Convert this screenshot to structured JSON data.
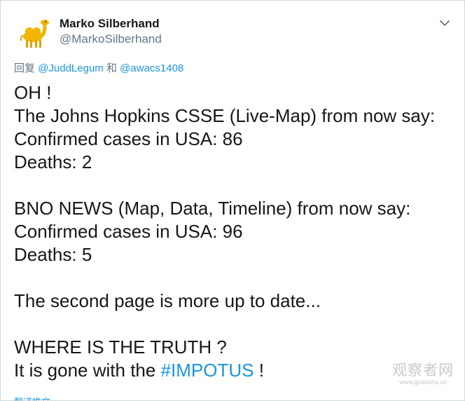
{
  "author": {
    "display_name": "Marko Silberhand",
    "handle": "@MarkoSilberhand",
    "avatar": "camel-avatar-icon"
  },
  "menu": {
    "icon": "chevron-down-icon"
  },
  "reply_to": {
    "prefix": "回复 ",
    "mention1": "@JuddLegum",
    "conjunction": " 和 ",
    "mention2": "@awacs1408"
  },
  "body": {
    "line1": "OH !",
    "line2": "The Johns Hopkins CSSE (Live-Map) from now say:",
    "line3": "Confirmed cases in USA: 86",
    "line4": "Deaths: 2",
    "line5": "BNO NEWS (Map, Data, Timeline) from now say:",
    "line6": "Confirmed cases in USA: 96",
    "line7": "Deaths: 5",
    "line8": "The second page is more up to date...",
    "line9": "WHERE IS THE TRUTH ?",
    "line10_prefix": "It is gone with the ",
    "hashtag": "#IMPOTUS",
    "line10_suffix": " !"
  },
  "watermark": {
    "main": "观察者网",
    "sub": "www.guancha.cn"
  },
  "footer_cutoff": "翻译推文"
}
